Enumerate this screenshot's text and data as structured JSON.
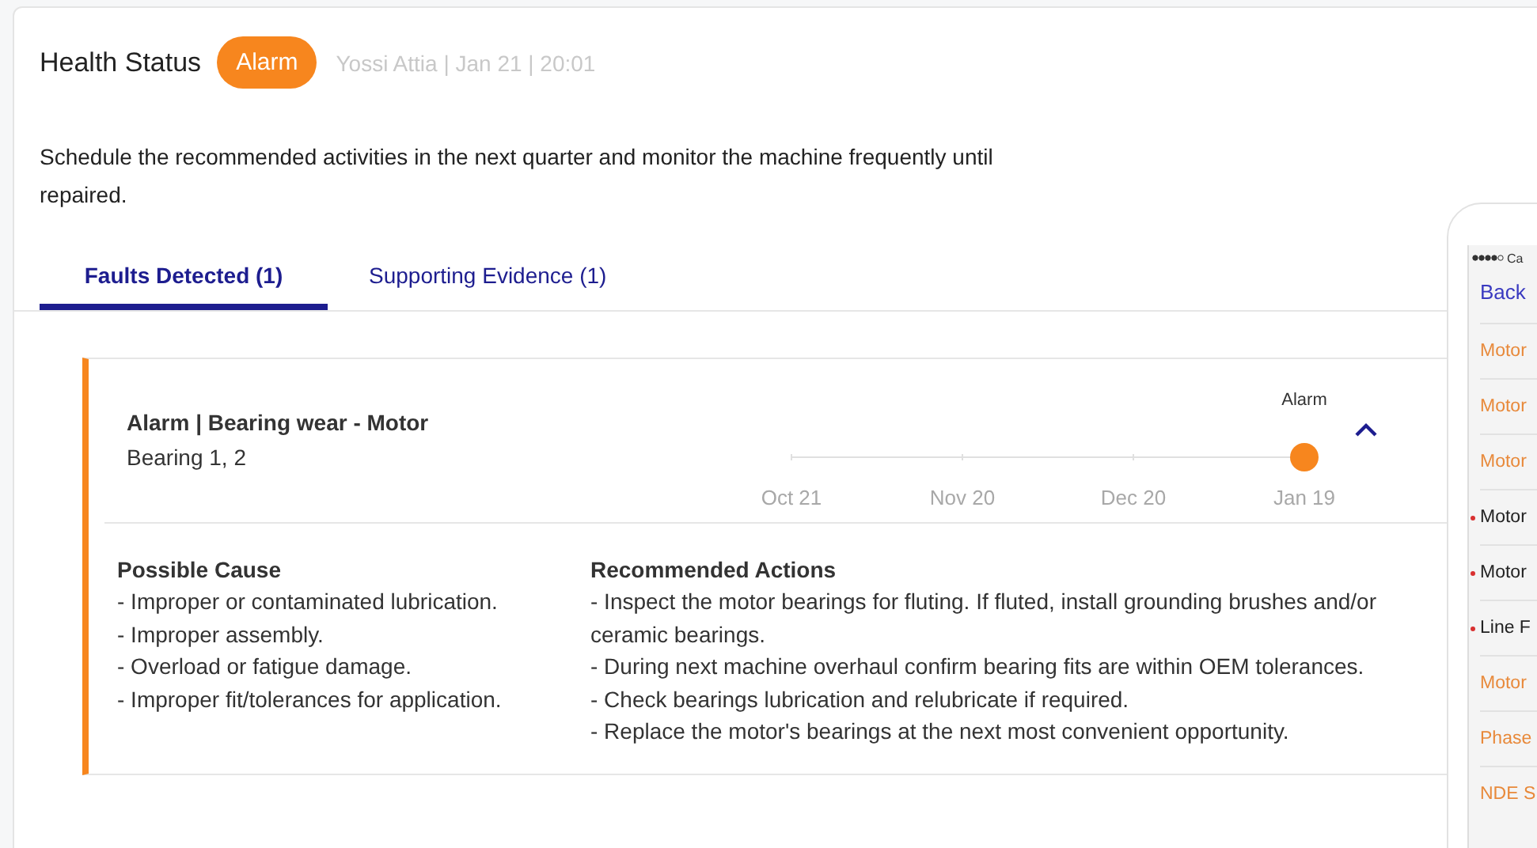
{
  "health_status": {
    "title": "Health Status",
    "badge": "Alarm",
    "meta": "Yossi Attia | Jan 21 | 20:01",
    "summary": "Schedule the recommended activities in the next quarter and monitor the machine frequently until repaired."
  },
  "tabs": [
    {
      "label": "Faults Detected (1)",
      "selected": true
    },
    {
      "label": "Supporting Evidence (1)",
      "selected": false
    }
  ],
  "fault": {
    "title": "Alarm | Bearing wear - Motor",
    "subtitle": "Bearing 1, 2",
    "expanded": true,
    "timeline": [
      {
        "date": "Oct 21"
      },
      {
        "date": "Nov 20"
      },
      {
        "date": "Dec 20"
      },
      {
        "date": "Jan 19",
        "event": "Alarm"
      }
    ],
    "sections": [
      {
        "heading": "Possible Cause",
        "lines": [
          "- Improper or contaminated lubrication.",
          "- Improper assembly.",
          "- Overload or fatigue damage.",
          "- Improper fit/tolerances for application."
        ]
      },
      {
        "heading": "Recommended Actions",
        "lines": [
          "- Inspect the motor bearings for fluting. If fluted, install grounding brushes and/or ceramic bearings.",
          "- During next machine overhaul confirm bearing fits are within OEM tolerances.",
          "- Check bearings lubrication and relubricate if required.",
          "- Replace the motor's bearings at the next most convenient opportunity."
        ]
      }
    ]
  },
  "phone": {
    "carrier": "Ca",
    "back": "Back",
    "items": [
      {
        "label": "Motor",
        "flagged": false
      },
      {
        "label": "Motor",
        "flagged": false
      },
      {
        "label": "Motor",
        "flagged": false
      },
      {
        "label": "Motor",
        "flagged": true
      },
      {
        "label": "Motor",
        "flagged": true
      },
      {
        "label": "Line F",
        "flagged": true
      },
      {
        "label": "Motor",
        "flagged": false
      },
      {
        "label": "Phase",
        "flagged": false
      },
      {
        "label": "NDE S",
        "flagged": false
      }
    ]
  }
}
